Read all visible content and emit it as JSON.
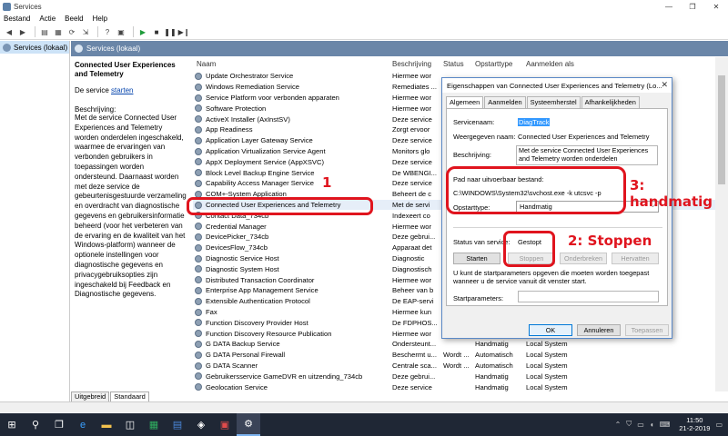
{
  "window": {
    "title": "Services",
    "controls": [
      "—",
      "❐",
      "✕"
    ]
  },
  "menu": [
    "Bestand",
    "Actie",
    "Beeld",
    "Help"
  ],
  "tree": {
    "item": "Services (lokaal)"
  },
  "panel": {
    "header": "Services (lokaal)"
  },
  "description": {
    "service_name": "Connected User Experiences and Telemetry",
    "start_prefix": "De service ",
    "start_link": "starten",
    "label": "Beschrijving:",
    "text": "Met de service Connected User Experiences and Telemetry worden onderdelen ingeschakeld, waarmee de ervaringen van verbonden gebruikers in toepassingen worden ondersteund. Daarnaast worden met deze service de gebeurtenisgestuurde verzameling en overdracht van diagnostische gegevens en gebruikersinformatie beheerd (voor het verbeteren van de ervaring en de kwaliteit van het Windows-platform) wanneer de optionele instellingen voor diagnostische gegevens en privacygebruiksopties zijn ingeschakeld bij Feedback en Diagnostische gegevens."
  },
  "columns": {
    "name": "Naam",
    "desc": "Beschrijving",
    "status": "Status",
    "startup": "Opstarttype",
    "logon": "Aanmelden als"
  },
  "rows": [
    {
      "name": "Update Orchestrator Service",
      "desc": "Hiermee wor",
      "status": "",
      "startup": "",
      "logon": ""
    },
    {
      "name": "Windows Remediation Service",
      "desc": "Remediates ...",
      "status": "",
      "startup": "",
      "logon": ""
    },
    {
      "name": "Service Platform voor verbonden apparaten",
      "desc": "Hiermee wor",
      "status": "",
      "startup": "",
      "logon": ""
    },
    {
      "name": "Software Protection",
      "desc": "Hiermee wor",
      "status": "",
      "startup": "",
      "logon": ""
    },
    {
      "name": "ActiveX Installer (AxInstSV)",
      "desc": "Deze service",
      "status": "",
      "startup": "",
      "logon": ""
    },
    {
      "name": "App Readiness",
      "desc": "Zorgt ervoor",
      "status": "",
      "startup": "",
      "logon": ""
    },
    {
      "name": "Application Layer Gateway Service",
      "desc": "Deze service",
      "status": "",
      "startup": "",
      "logon": ""
    },
    {
      "name": "Application Virtualization Service Agent",
      "desc": "Monitors glo",
      "status": "",
      "startup": "",
      "logon": ""
    },
    {
      "name": "AppX Deployment Service (AppXSVC)",
      "desc": "Deze service",
      "status": "",
      "startup": "",
      "logon": ""
    },
    {
      "name": "Block Level Backup Engine Service",
      "desc": "De WBENGI...",
      "status": "",
      "startup": "",
      "logon": ""
    },
    {
      "name": "Capability Access Manager Service",
      "desc": "Deze service",
      "status": "",
      "startup": "",
      "logon": ""
    },
    {
      "name": "COM+-System Application",
      "desc": "Beheert de c",
      "status": "",
      "startup": "",
      "logon": ""
    },
    {
      "name": "Connected User Experiences and Telemetry",
      "desc": "Met de servi",
      "status": "",
      "startup": "",
      "logon": ""
    },
    {
      "name": "Contact Data_734cb",
      "desc": "Indexeert co",
      "status": "",
      "startup": "",
      "logon": ""
    },
    {
      "name": "Credential Manager",
      "desc": "Hiermee wor",
      "status": "",
      "startup": "",
      "logon": ""
    },
    {
      "name": "DevicePicker_734cb",
      "desc": "Deze gebrui...",
      "status": "",
      "startup": "",
      "logon": ""
    },
    {
      "name": "DevicesFlow_734cb",
      "desc": "Apparaat det",
      "status": "",
      "startup": "",
      "logon": ""
    },
    {
      "name": "Diagnostic Service Host",
      "desc": "Diagnostic",
      "status": "",
      "startup": "",
      "logon": ""
    },
    {
      "name": "Diagnostic System Host",
      "desc": "Diagnostisch",
      "status": "",
      "startup": "",
      "logon": ""
    },
    {
      "name": "Distributed Transaction Coordinator",
      "desc": "Hiermee wor",
      "status": "",
      "startup": "",
      "logon": ""
    },
    {
      "name": "Enterprise App Management Service",
      "desc": "Beheer van b",
      "status": "",
      "startup": "",
      "logon": ""
    },
    {
      "name": "Extensible Authentication Protocol",
      "desc": "De EAP-servi",
      "status": "",
      "startup": "",
      "logon": ""
    },
    {
      "name": "Fax",
      "desc": "Hiermee kun",
      "status": "",
      "startup": "",
      "logon": ""
    },
    {
      "name": "Function Discovery Provider Host",
      "desc": "De FDPHOS...",
      "status": "",
      "startup": "",
      "logon": ""
    },
    {
      "name": "Function Discovery Resource Publication",
      "desc": "Hiermee wor",
      "status": "",
      "startup": "",
      "logon": ""
    },
    {
      "name": "G DATA Backup Service",
      "desc": "Ondersteunt...",
      "status": "",
      "startup": "Handmatig",
      "logon": "Local System"
    },
    {
      "name": "G DATA Personal Firewall",
      "desc": "Beschermt u...",
      "status": "Wordt ...",
      "startup": "Automatisch",
      "logon": "Local System"
    },
    {
      "name": "G DATA Scanner",
      "desc": "Centrale sca...",
      "status": "Wordt ...",
      "startup": "Automatisch",
      "logon": "Local System"
    },
    {
      "name": "Gebruikersservice GameDVR en uitzending_734cb",
      "desc": "Deze gebrui...",
      "status": "",
      "startup": "Handmatig",
      "logon": "Local System"
    },
    {
      "name": "Geolocation Service",
      "desc": "Deze service",
      "status": "",
      "startup": "Handmatig",
      "logon": "Local System"
    }
  ],
  "tabs_bottom": [
    "Uitgebreid",
    "Standaard"
  ],
  "annotations": {
    "one": "1",
    "two": "2: Stoppen",
    "three": "3: handmatig"
  },
  "dialog": {
    "title": "Eigenschappen van Connected User Experiences and Telemetry (Lo...",
    "close": "✕",
    "tabs": [
      "Algemeen",
      "Aanmelden",
      "Systeemherstel",
      "Afhankelijkheden"
    ],
    "service_name_label": "Servicenaam:",
    "service_name_value": "DiagTrack",
    "display_name_label": "Weergegeven naam:",
    "display_name_value": "Connected User Experiences and Telemetry",
    "description_label": "Beschrijving:",
    "description_value": "Met de service Connected User Experiences and Telemetry worden onderdelen",
    "path_label": "Pad naar uitvoerbaar bestand:",
    "path_value": "C:\\WINDOWS\\System32\\svchost.exe -k utcsvc -p",
    "startup_label": "Opstarttype:",
    "startup_value": "Handmatig",
    "status_label": "Status van service:",
    "status_value": "Gestopt",
    "btn_start": "Starten",
    "btn_stop": "Stoppen",
    "btn_pause": "Onderbreken",
    "btn_resume": "Hervatten",
    "hint": "U kunt de startparameters opgeven die moeten worden toegepast wanneer u de service vanuit dit venster start.",
    "params_label": "Startparameters:",
    "btn_ok": "OK",
    "btn_cancel": "Annuleren",
    "btn_apply": "Toepassen"
  },
  "taskbar": {
    "clock_time": "11:50",
    "clock_date": "21-2-2019"
  }
}
